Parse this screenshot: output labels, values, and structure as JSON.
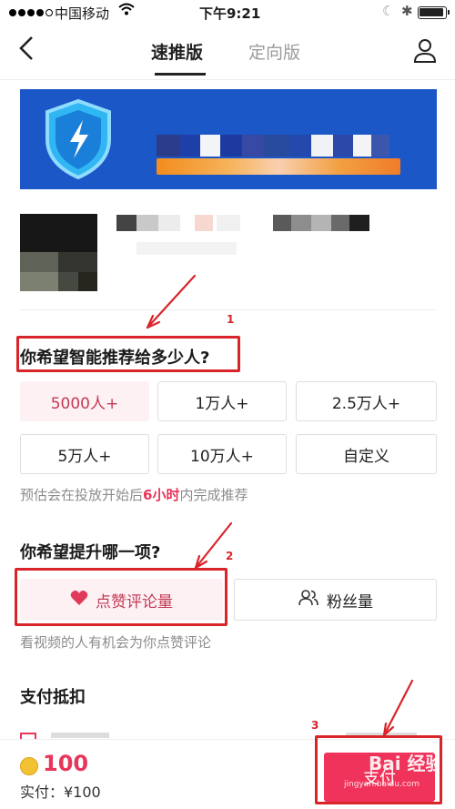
{
  "status_bar": {
    "carrier": "中国移动",
    "time": "下午9:21"
  },
  "nav": {
    "tabs": [
      {
        "label": "速推版",
        "active": true
      },
      {
        "label": "定向版",
        "active": false
      }
    ]
  },
  "reach": {
    "title": "你希望智能推荐给多少人?",
    "options": [
      "5000人+",
      "1万人+",
      "2.5万人+",
      "5万人+",
      "10万人+",
      "自定义"
    ],
    "selected_index": 0,
    "hint_prefix": "预估会在投放开始后",
    "hint_highlight": "6小时",
    "hint_suffix": "内完成推荐"
  },
  "goal": {
    "title": "你希望提升哪一项?",
    "options": [
      "点赞评论量",
      "粉丝量"
    ],
    "selected_index": 0,
    "hint": "看视频的人有机会为你点赞评论"
  },
  "payment": {
    "title": "支付抵扣",
    "price": "100",
    "paid_label": "实付：¥100",
    "pay_button": "支付"
  },
  "annotations": [
    "1",
    "2",
    "3"
  ],
  "watermark": {
    "logo": "Bai 经验",
    "url": "jingyan.baidu.com"
  },
  "colors": {
    "accent": "#f0335a",
    "selected_bg": "#fdf1f3",
    "annotation": "#d8252a",
    "banner": "#1b57c6"
  },
  "icons": [
    "back-arrow",
    "user-icon",
    "shield-lightning-icon",
    "heart-icon",
    "people-icon",
    "coin-icon"
  ]
}
